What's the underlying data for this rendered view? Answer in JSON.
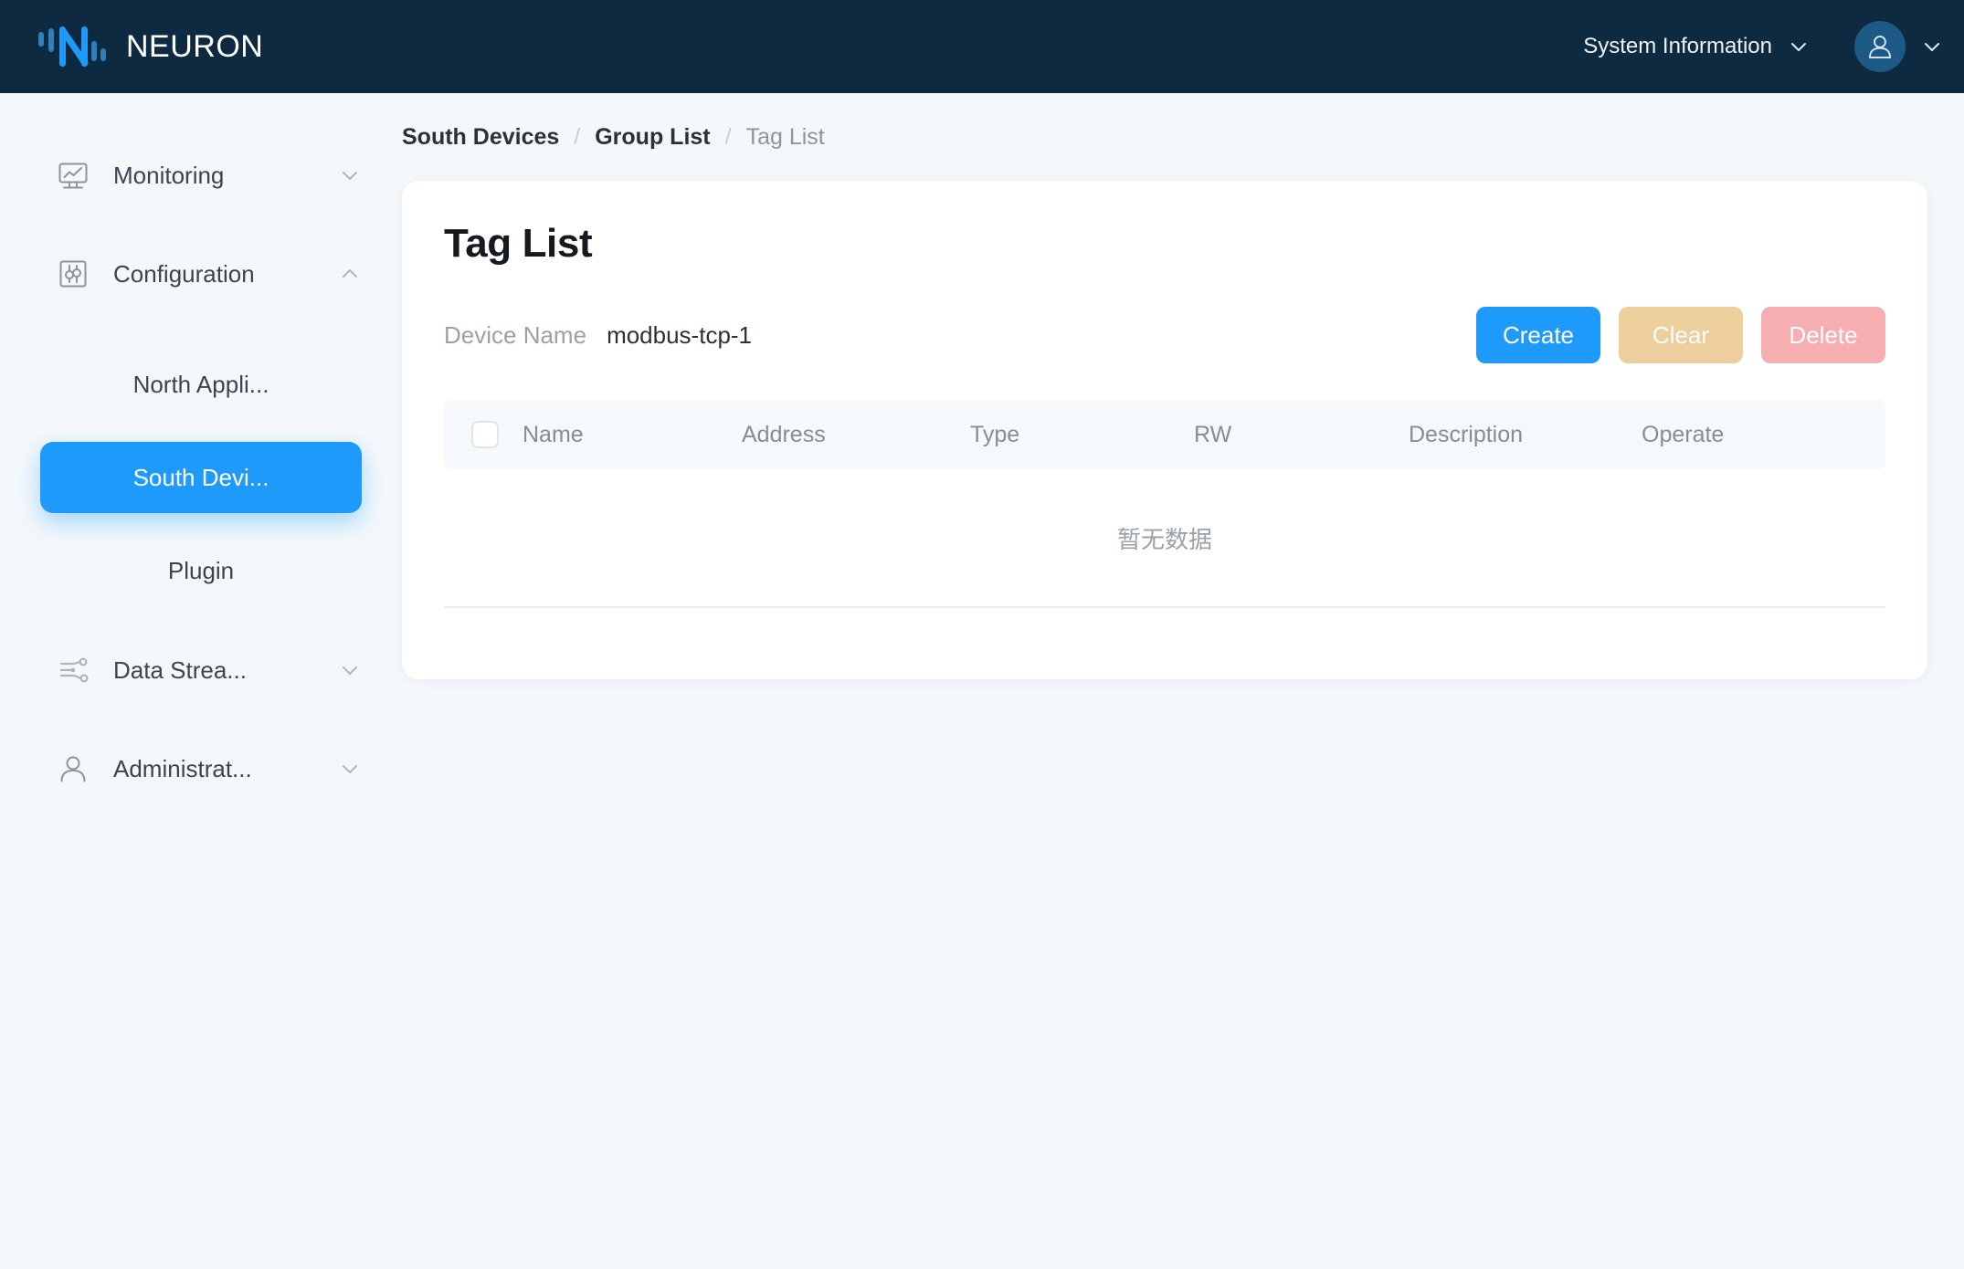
{
  "colors": {
    "header_bg": "#0d2a40",
    "page_bg": "#f4f8fb",
    "accent": "#1e9bfa",
    "clear_btn": "#eccf9c",
    "delete_btn": "#f6aeb1",
    "table_head_bg": "#f5f9fb",
    "muted_text": "#9aa1aa"
  },
  "header": {
    "brand_name": "NEURON",
    "logo_icon": "neuron-logo-icon",
    "system_info_label": "System Information",
    "system_info_caret_icon": "chevron-down-icon",
    "avatar_icon": "user-avatar-icon",
    "avatar_caret_icon": "chevron-down-icon"
  },
  "sidebar": {
    "items": [
      {
        "label": "Monitoring",
        "icon": "monitor-chart-icon",
        "caret": "chevron-down-icon",
        "type": "group",
        "expanded": false
      },
      {
        "label": "Configuration",
        "icon": "sliders-square-icon",
        "caret": "chevron-up-icon",
        "type": "group",
        "expanded": true
      },
      {
        "label": "North Appli...",
        "type": "sub",
        "active": false
      },
      {
        "label": "South Devi...",
        "type": "sub",
        "active": true
      },
      {
        "label": "Plugin",
        "type": "sub",
        "active": false
      },
      {
        "label": "Data Strea...",
        "icon": "data-stream-icon",
        "caret": "chevron-down-icon",
        "type": "group",
        "expanded": false
      },
      {
        "label": "Administrat...",
        "icon": "person-icon",
        "caret": "chevron-down-icon",
        "type": "group",
        "expanded": false
      }
    ]
  },
  "breadcrumb": {
    "items": [
      {
        "label": "South Devices",
        "current": false
      },
      {
        "label": "Group List",
        "current": false
      },
      {
        "label": "Tag List",
        "current": true
      }
    ],
    "separator": "/"
  },
  "main": {
    "page_title": "Tag List",
    "device_name_label": "Device Name",
    "device_name_value": "modbus-tcp-1",
    "buttons": {
      "create": "Create",
      "clear": "Clear",
      "delete": "Delete"
    },
    "table": {
      "select_all_checked": false,
      "columns": [
        "Name",
        "Address",
        "Type",
        "RW",
        "Description",
        "Operate"
      ],
      "rows": [],
      "empty_text": "暂无数据"
    }
  }
}
